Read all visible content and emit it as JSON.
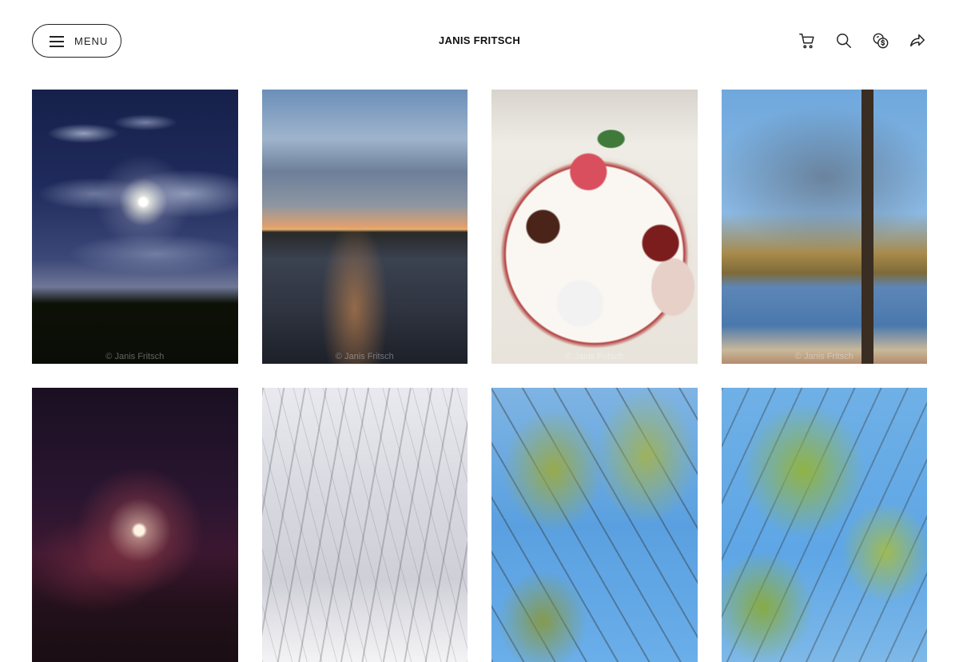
{
  "header": {
    "menu_label": "MENU",
    "site_title": "JANIS FRITSCH",
    "icons": [
      "cart-icon",
      "search-icon",
      "currency-icon",
      "share-icon"
    ]
  },
  "gallery": {
    "watermark": "© Janis Fritsch",
    "photos": [
      {
        "subject": "moon-clouds-night"
      },
      {
        "subject": "sunset-over-lake"
      },
      {
        "subject": "dessert-plate"
      },
      {
        "subject": "autumn-tree-by-water"
      },
      {
        "subject": "moon-through-branches"
      },
      {
        "subject": "snowy-trees"
      },
      {
        "subject": "green-tree-canopy"
      },
      {
        "subject": "green-tree-canopy-2"
      }
    ]
  },
  "colors": {
    "background": "#ffffff",
    "text": "#111111",
    "border": "#222222"
  }
}
